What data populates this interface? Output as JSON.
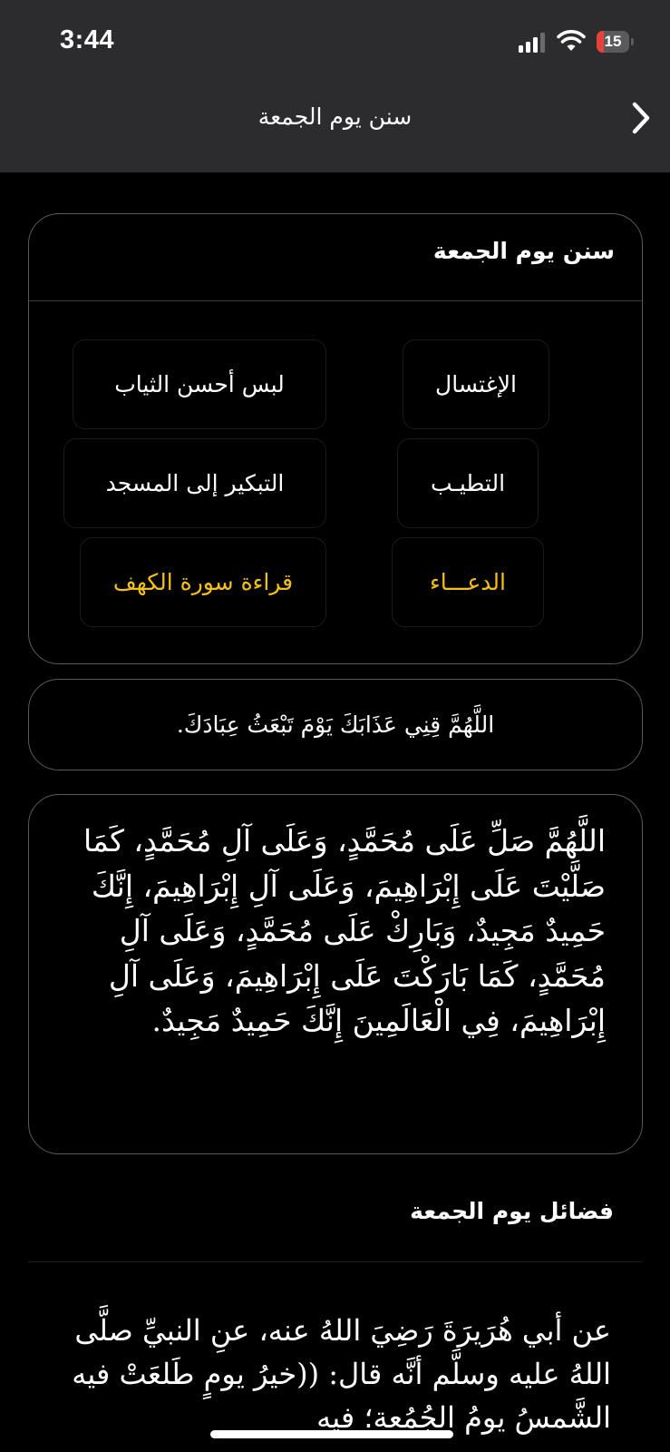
{
  "status_bar": {
    "time": "3:44",
    "battery_level": "15",
    "battery_color": "#e5433a"
  },
  "nav": {
    "title": "سنن يوم الجمعة",
    "back_icon": "chevron-right-icon"
  },
  "sunnah_card": {
    "title": "سنن يوم الجمعة",
    "items": [
      {
        "label": "الإغتسال",
        "active": false
      },
      {
        "label": "لبس أحسن الثياب",
        "active": false
      },
      {
        "label": "التطيـب",
        "active": false
      },
      {
        "label": "التبكير إلى المسجد",
        "active": false
      },
      {
        "label": "الدعـــاء",
        "active": true
      },
      {
        "label": "قراءة سورة الكهف",
        "active": true
      }
    ],
    "active_color": "#f5c115"
  },
  "dua": "اللَّهُمَّ قِنِي عَذَابَكَ يَوْمَ تَبْعَثُ عِبَادَكَ.",
  "salawat": "اللَّهُمَّ صَلِّ عَلَى مُحَمَّدٍ، وَعَلَى آلِ مُحَمَّدٍ، كَمَا صَلَّيْتَ عَلَى إِبْرَاهِيمَ، وَعَلَى آلِ إِبْرَاهِيمَ، إِنَّكَ حَمِيدٌ مَجِيدٌ، وَبَارِكْ عَلَى مُحَمَّدٍ، وَعَلَى آلِ مُحَمَّدٍ، كَمَا بَارَكْتَ عَلَى إِبْرَاهِيمَ، وَعَلَى آلِ إِبْرَاهِيمَ، فِي الْعَالَمِينَ إِنَّكَ حَمِيدٌ مَجِيدٌ.",
  "virtues": {
    "title": "فضائل يوم الجمعة",
    "hadith": "عن أبي هُرَيرَةَ رَضِيَ اللهُ عنه، عنِ النبيِّ صلَّى اللهُ عليه وسلَّم أنَّه قال: ((خيرُ يومٍ طَلعَتْ فيه الشَّمسُ يومُ الجُمُعة؛ فيه"
  }
}
